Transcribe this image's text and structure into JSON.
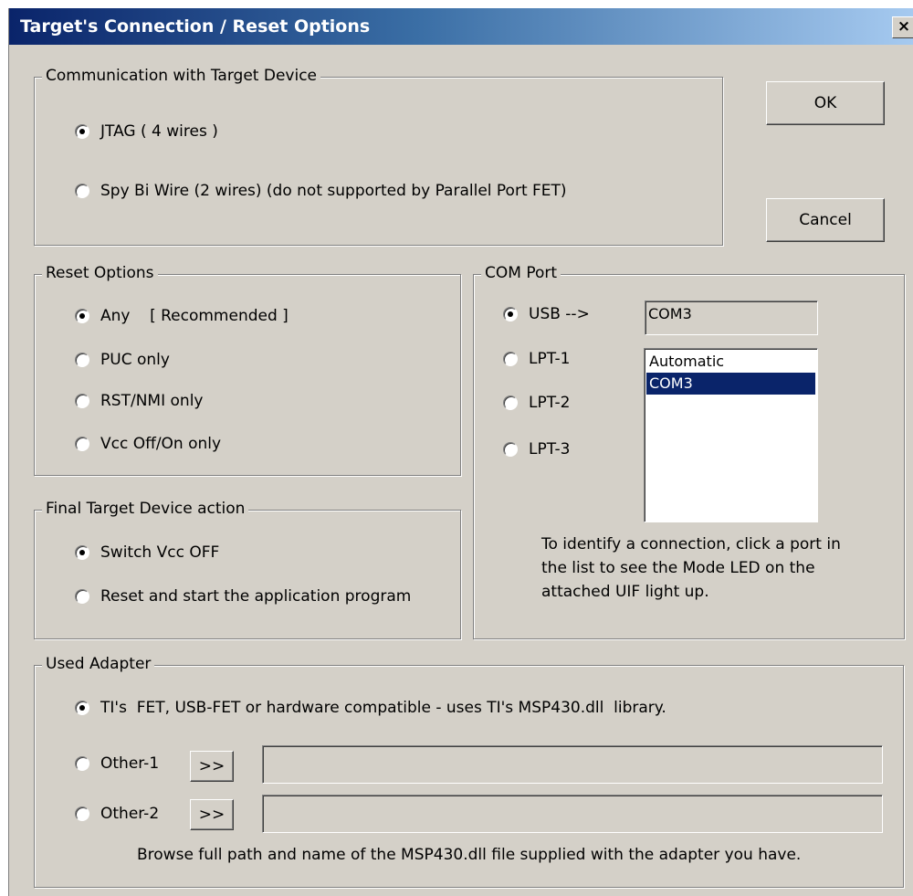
{
  "window": {
    "title": "Target's Connection / Reset Options",
    "close": "×"
  },
  "buttons": {
    "ok": "OK",
    "cancel": "Cancel"
  },
  "communication": {
    "legend": "Communication with Target Device",
    "options": [
      {
        "label": "JTAG ( 4 wires )",
        "selected": true
      },
      {
        "label": "Spy Bi Wire (2 wires) (do not supported by Parallel Port FET)",
        "selected": false
      }
    ]
  },
  "reset": {
    "legend": "Reset Options",
    "options": [
      {
        "label": "Any    [ Recommended ]",
        "selected": true
      },
      {
        "label": "PUC only",
        "selected": false
      },
      {
        "label": "RST/NMI only",
        "selected": false
      },
      {
        "label": "Vcc Off/On only",
        "selected": false
      }
    ]
  },
  "final_action": {
    "legend": "Final Target Device action",
    "options": [
      {
        "label": "Switch Vcc OFF",
        "selected": true
      },
      {
        "label": "Reset and start the application program",
        "selected": false
      }
    ]
  },
  "com_port": {
    "legend": "COM Port",
    "options": [
      {
        "label": "USB -->",
        "selected": true
      },
      {
        "label": "LPT-1",
        "selected": false
      },
      {
        "label": "LPT-2",
        "selected": false
      },
      {
        "label": "LPT-3",
        "selected": false
      }
    ],
    "current_value": "COM3",
    "list_items": [
      {
        "label": "Automatic",
        "selected": false
      },
      {
        "label": "COM3",
        "selected": true
      }
    ],
    "hint_lines": [
      "To identify a connection, click a port in",
      "the list to see the Mode LED on the",
      "attached UIF light up."
    ]
  },
  "adapter": {
    "legend": "Used Adapter",
    "options": [
      {
        "label": "TI's  FET, USB-FET or hardware compatible - uses TI's MSP430.dll  library.",
        "selected": true
      },
      {
        "label": "Other-1",
        "selected": false
      },
      {
        "label": "Other-2",
        "selected": false
      }
    ],
    "browse_label": ">>",
    "path1": "",
    "path2": "",
    "note": "Browse full path and name of the MSP430.dll file supplied with the adapter you have."
  }
}
